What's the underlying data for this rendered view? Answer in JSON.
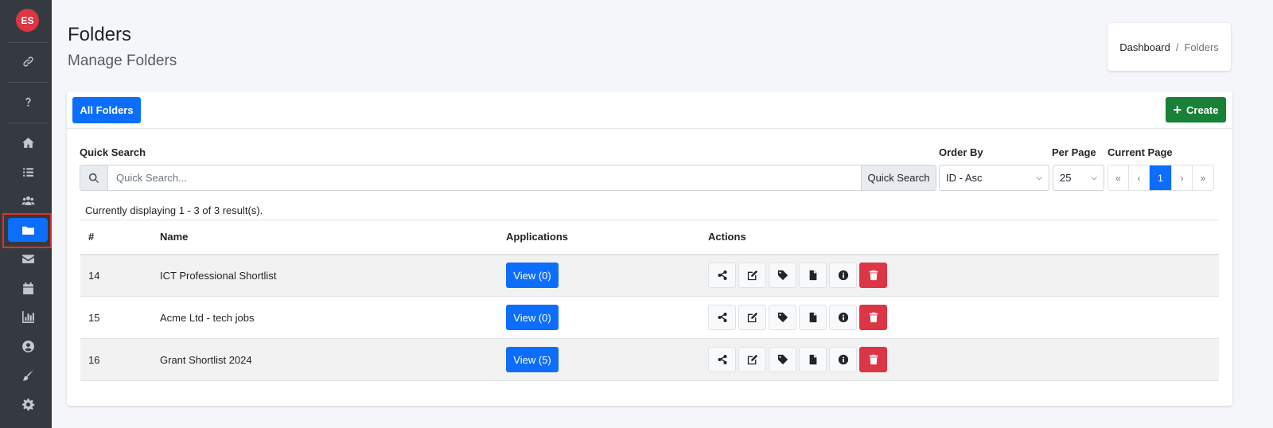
{
  "sidebar": {
    "avatar": "ES",
    "items": [
      {
        "icon": "link-icon"
      },
      {
        "icon": "question-icon"
      },
      {
        "icon": "home-icon"
      },
      {
        "icon": "list-icon"
      },
      {
        "icon": "users-icon"
      },
      {
        "icon": "folder-icon",
        "active": true
      },
      {
        "icon": "envelope-icon"
      },
      {
        "icon": "calendar-icon"
      },
      {
        "icon": "chart-icon"
      },
      {
        "icon": "user-circle-icon"
      },
      {
        "icon": "paint-brush-icon"
      },
      {
        "icon": "gear-icon"
      }
    ]
  },
  "header": {
    "title": "Folders",
    "subtitle": "Manage Folders"
  },
  "breadcrumb": {
    "home": "Dashboard",
    "separator": "/",
    "current": "Folders"
  },
  "toolbar": {
    "all_folders": "All Folders",
    "create": "Create",
    "create_icon": "+"
  },
  "filters": {
    "quick_search_label": "Quick Search",
    "search_placeholder": "Quick Search...",
    "search_button": "Quick Search",
    "order_by_label": "Order By",
    "order_by_value": "ID - Asc",
    "per_page_label": "Per Page",
    "per_page_value": "25",
    "current_page_label": "Current Page",
    "pager": {
      "first": "«",
      "prev": "‹",
      "current": "1",
      "next": "›",
      "last": "»"
    }
  },
  "results_text": "Currently displaying 1 - 3 of 3 result(s).",
  "table": {
    "columns": [
      "#",
      "Name",
      "Applications",
      "Actions"
    ],
    "rows": [
      {
        "id": "14",
        "name": "ICT Professional Shortlist",
        "applications": "View (0)"
      },
      {
        "id": "15",
        "name": "Acme Ltd - tech jobs",
        "applications": "View (0)"
      },
      {
        "id": "16",
        "name": "Grant Shortlist 2024",
        "applications": "View (5)"
      }
    ],
    "action_icons": [
      "share-icon",
      "edit-icon",
      "tag-icon",
      "file-icon",
      "info-icon",
      "trash-icon"
    ]
  },
  "colors": {
    "sidebar_bg": "#343a40",
    "primary": "#0d6efd",
    "success": "#198038",
    "danger": "#dc3545"
  }
}
